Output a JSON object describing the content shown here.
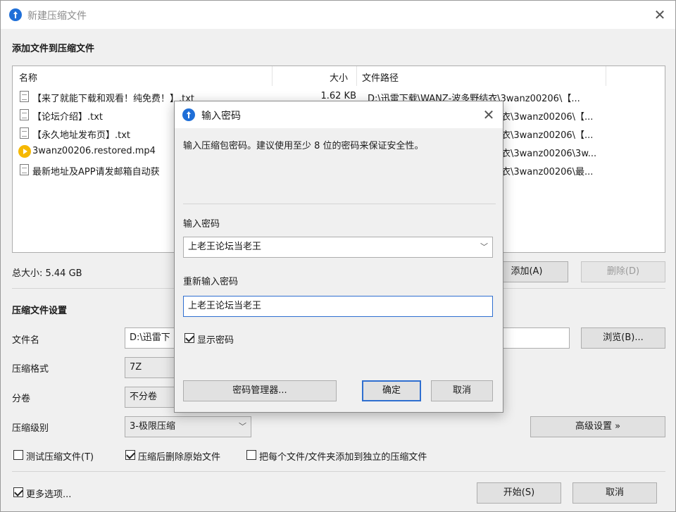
{
  "window": {
    "title": "新建压缩文件"
  },
  "files_section": {
    "heading": "添加文件到压缩文件"
  },
  "file_list": {
    "columns": {
      "name": "名称",
      "size": "大小",
      "path": "文件路径"
    },
    "rows": [
      {
        "name": "【来了就能下载和观看！纯免费！】.txt",
        "size": "1.62 KB",
        "path": "D:\\迅雷下载\\WANZ-波多野结衣\\3wanz00206\\【...",
        "icon": "text-file-icon"
      },
      {
        "name": "【论坛介绍】.txt",
        "size": "",
        "path": "衣\\3wanz00206\\【...",
        "icon": "text-file-icon"
      },
      {
        "name": "【永久地址发布页】.txt",
        "size": "",
        "path": "衣\\3wanz00206\\【...",
        "icon": "text-file-icon"
      },
      {
        "name": "3wanz00206.restored.mp4",
        "size": "",
        "path": "衣\\3wanz00206\\3w...",
        "icon": "media-file-icon"
      },
      {
        "name": "最新地址及APP请发邮箱自动获",
        "size": "",
        "path": "衣\\3wanz00206\\最...",
        "icon": "text-file-icon"
      }
    ]
  },
  "summary": {
    "total_size": "总大小: 5.44 GB",
    "add_label": "添加(A)",
    "delete_label": "删除(D)"
  },
  "settings": {
    "heading": "压缩文件设置",
    "filename_label": "文件名",
    "filename_value": "D:\\迅雷下",
    "browse_label": "浏览(B)...",
    "format_label": "压缩格式",
    "format_value": "7Z",
    "split_label": "分卷",
    "split_value": "不分卷",
    "level_label": "压缩级别",
    "level_value": "3-极限压缩",
    "advanced_label": "高级设置 »"
  },
  "options": {
    "test_label": "测试压缩文件(T)",
    "test_checked": false,
    "delete_label": "压缩后删除原始文件",
    "delete_checked": true,
    "separate_label": "把每个文件/文件夹添加到独立的压缩文件",
    "separate_checked": false
  },
  "footer": {
    "more_label": "更多选项...",
    "more_checked": true,
    "start_label": "开始(S)",
    "cancel_label": "取消"
  },
  "dialog": {
    "title": "输入密码",
    "hint": "输入压缩包密码。建议使用至少 8 位的密码来保证安全性。",
    "password_label": "输入密码",
    "password_value": "上老王论坛当老王",
    "confirm_label": "重新输入密码",
    "confirm_value": "上老王论坛当老王",
    "show_password_label": "显示密码",
    "show_password_checked": true,
    "manager_label": "密码管理器...",
    "ok_label": "确定",
    "cancel_label": "取消"
  },
  "colors": {
    "accent": "#2f6fd0",
    "app_icon": "#1f6fd8",
    "media_icon": "#f6b800"
  }
}
